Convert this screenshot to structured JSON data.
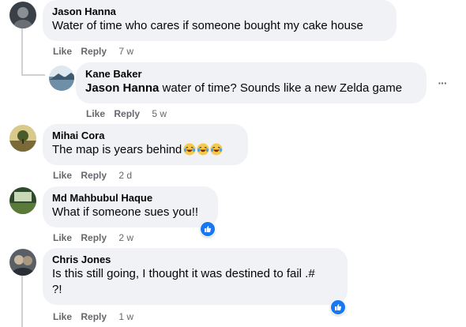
{
  "comments": [
    {
      "author": "Jason Hanna",
      "text": "Water of time who cares if someone bought my cake house",
      "actions": {
        "like": "Like",
        "reply": "Reply",
        "time": "7 w"
      },
      "avatar_color": "#3a4048"
    },
    {
      "author": "Kane Baker",
      "mention": "Jason Hanna",
      "text": " water of time? Sounds like a new Zelda game",
      "actions": {
        "like": "Like",
        "reply": "Reply",
        "time": "5 w"
      },
      "more_label": "···",
      "avatar_color": "#6e8fa6"
    },
    {
      "author": "Mihai Cora",
      "text": "The map is years behind",
      "emojis": [
        "laughing-tears",
        "laughing-tears",
        "laughing-tears"
      ],
      "actions": {
        "like": "Like",
        "reply": "Reply",
        "time": "2 d"
      },
      "avatar_color": "#7a6a3a"
    },
    {
      "author": "Md Mahbubul Haque",
      "text": "What if someone sues you!!",
      "actions": {
        "like": "Like",
        "reply": "Reply",
        "time": "2 w"
      },
      "reaction": "like",
      "avatar_color": "#2f4a2a"
    },
    {
      "author": "Chris Jones",
      "text_line1": "Is this still going, I thought it was destined to fail .#",
      "text_line2": "?!",
      "actions": {
        "like": "Like",
        "reply": "Reply",
        "time": "1 w"
      },
      "reaction": "like",
      "avatar_color": "#5a5f66"
    }
  ],
  "colors": {
    "bubble": "#f0f2f5",
    "meta_text": "#65676b",
    "like_blue": "#1877f2",
    "thread_line": "#ced0d4"
  }
}
